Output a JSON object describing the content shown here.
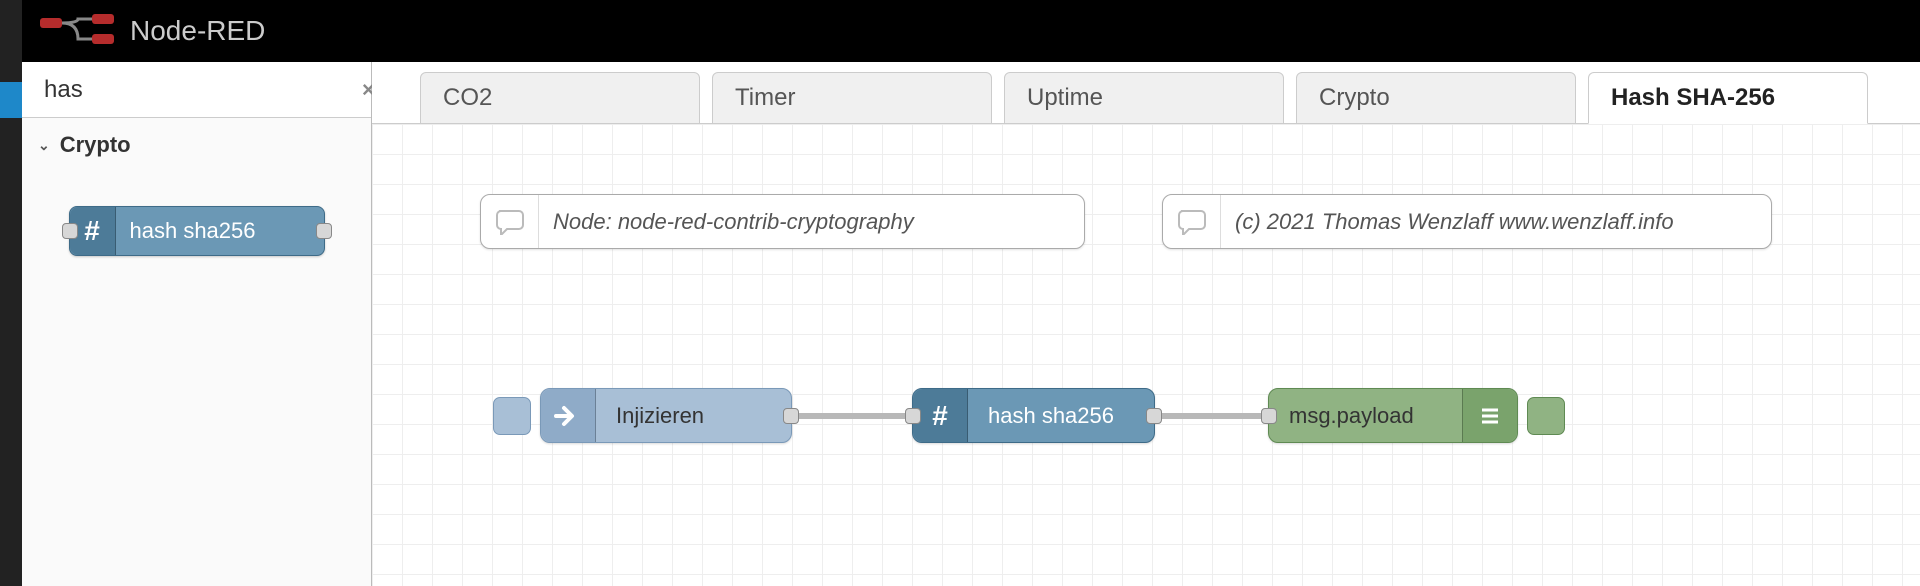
{
  "header": {
    "title": "Node-RED"
  },
  "sidebar": {
    "search_value": "has",
    "category": "Crypto",
    "palette_node_label": "hash sha256"
  },
  "tabs": [
    {
      "label": "CO2",
      "active": false
    },
    {
      "label": "Timer",
      "active": false
    },
    {
      "label": "Uptime",
      "active": false
    },
    {
      "label": "Crypto",
      "active": false
    },
    {
      "label": "Hash SHA-256",
      "active": true
    }
  ],
  "canvas": {
    "comment1": "Node: node-red-contrib-cryptography",
    "comment2": "(c) 2021 Thomas Wenzlaff www.wenzlaff.info",
    "inject_label": "Injizieren",
    "hash_label": "hash sha256",
    "debug_label": "msg.payload"
  }
}
